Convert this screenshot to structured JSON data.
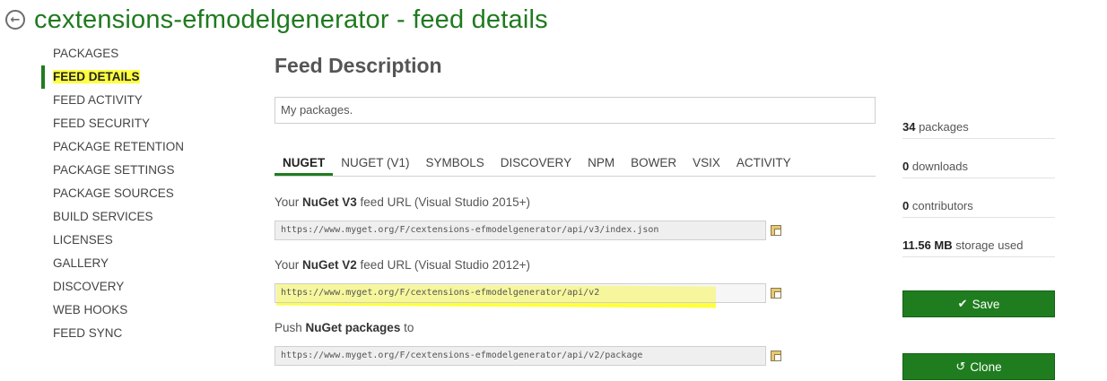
{
  "header": {
    "title": "cextensions-efmodelgenerator - feed details",
    "back_icon": "back-arrow-icon"
  },
  "sidebar": {
    "items": [
      {
        "label": "PACKAGES",
        "active": false
      },
      {
        "label": "FEED DETAILS",
        "active": true
      },
      {
        "label": "FEED ACTIVITY",
        "active": false
      },
      {
        "label": "FEED SECURITY",
        "active": false
      },
      {
        "label": "PACKAGE RETENTION",
        "active": false
      },
      {
        "label": "PACKAGE SETTINGS",
        "active": false
      },
      {
        "label": "PACKAGE SOURCES",
        "active": false
      },
      {
        "label": "BUILD SERVICES",
        "active": false
      },
      {
        "label": "LICENSES",
        "active": false
      },
      {
        "label": "GALLERY",
        "active": false
      },
      {
        "label": "DISCOVERY",
        "active": false
      },
      {
        "label": "WEB HOOKS",
        "active": false
      },
      {
        "label": "FEED SYNC",
        "active": false
      }
    ]
  },
  "main": {
    "section_title": "Feed Description",
    "description": "My packages.",
    "tabs": [
      "NUGET",
      "NUGET (V1)",
      "SYMBOLS",
      "DISCOVERY",
      "NPM",
      "BOWER",
      "VSIX",
      "ACTIVITY"
    ],
    "active_tab": "NUGET",
    "urls": [
      {
        "prefix": "Your ",
        "bold": "NuGet V3",
        "suffix": " feed URL (Visual Studio 2015+)",
        "value": "https://www.myget.org/F/cextensions-efmodelgenerator/api/v3/index.json"
      },
      {
        "prefix": "Your ",
        "bold": "NuGet V2",
        "suffix": " feed URL (Visual Studio 2012+)",
        "value": "https://www.myget.org/F/cextensions-efmodelgenerator/api/v2"
      },
      {
        "prefix": "Push ",
        "bold": "NuGet packages",
        "suffix": " to",
        "value": "https://www.myget.org/F/cextensions-efmodelgenerator/api/v2/package"
      }
    ]
  },
  "stats": [
    {
      "value": "34",
      "label": " packages"
    },
    {
      "value": "0",
      "label": " downloads"
    },
    {
      "value": "0",
      "label": " contributors"
    },
    {
      "value": "11.56 MB",
      "label": " storage used"
    }
  ],
  "buttons": {
    "save": "Save",
    "clone": "Clone"
  },
  "colors": {
    "brand_green": "#1f7d1f",
    "title_green": "#1f7a1f",
    "highlight": "#ffff40"
  }
}
